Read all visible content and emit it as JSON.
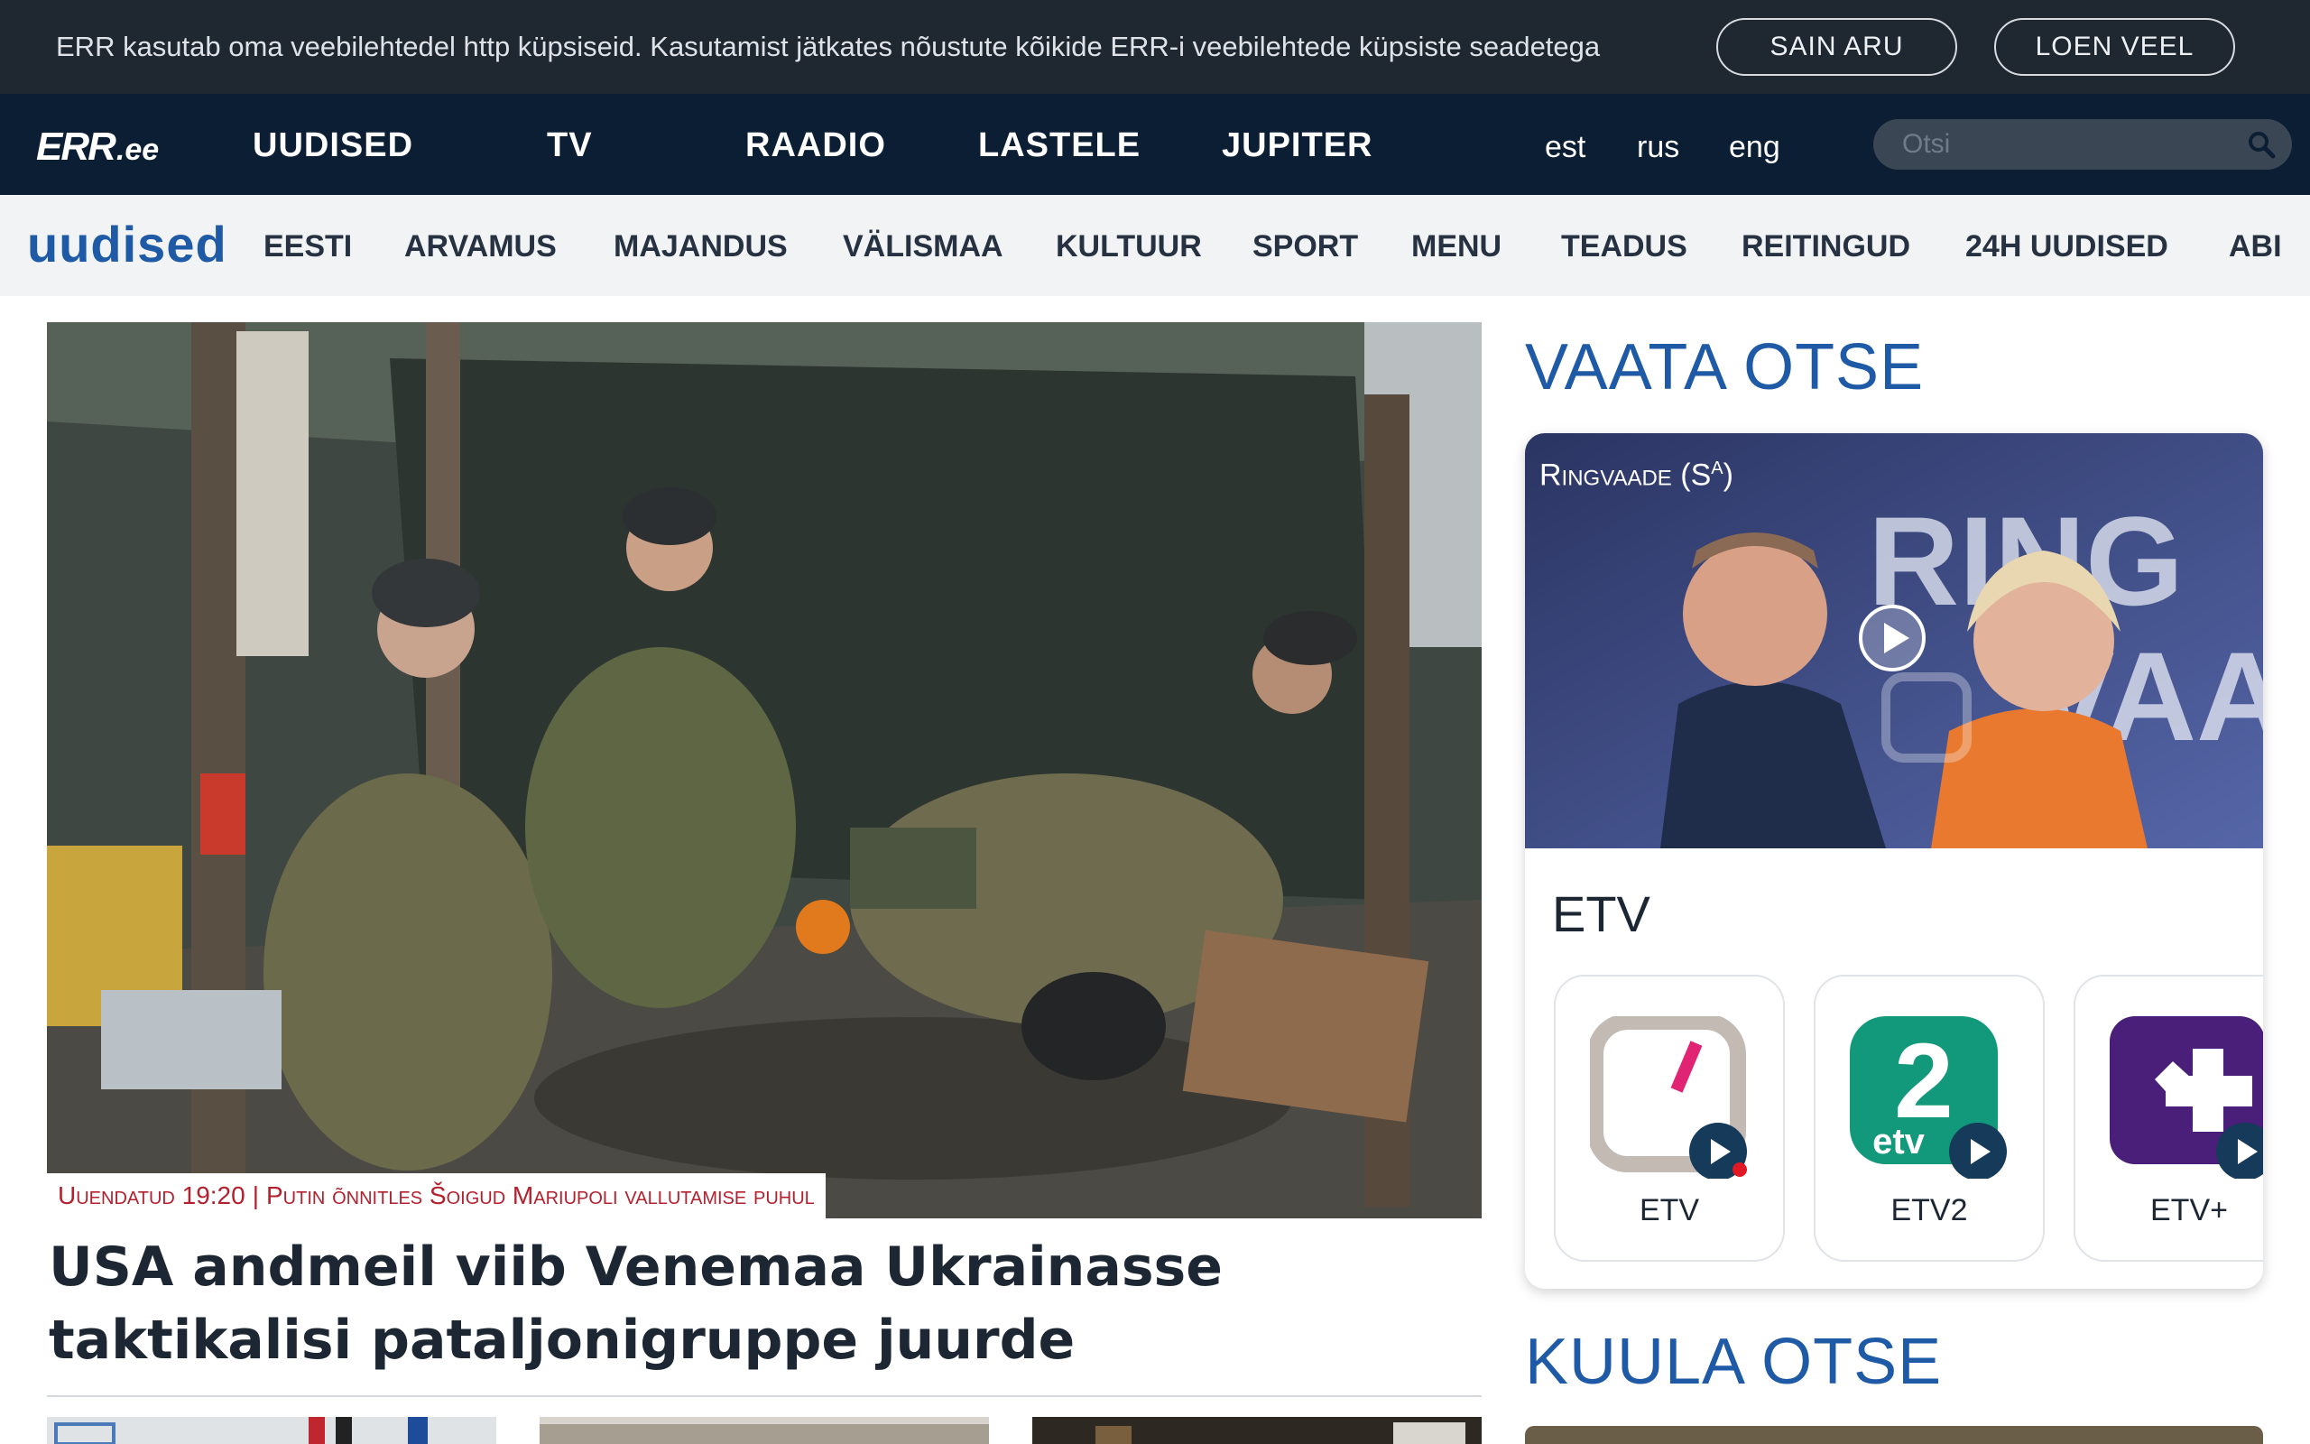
{
  "cookie": {
    "text": "ERR kasutab oma veebilehtedel http küpsiseid. Kasutamist jätkates nõustute kõikide ERR-i veebilehtede küpsiste seadetega",
    "accept_label": "SAIN ARU",
    "more_label": "LOEN VEEL"
  },
  "header": {
    "logo_main": "ERR",
    "logo_suffix": ".ee",
    "nav": [
      "UUDISED",
      "TV",
      "RAADIO",
      "LASTELE",
      "JUPITER"
    ],
    "languages": [
      "est",
      "rus",
      "eng"
    ],
    "search_placeholder": "Otsi"
  },
  "subnav": {
    "title": "uudised",
    "items": [
      "EESTI",
      "ARVAMUS",
      "MAJANDUS",
      "VÄLISMAA",
      "KULTUUR",
      "SPORT",
      "MENU",
      "TEADUS",
      "REITINGUD",
      "24H UUDISED",
      "ABI"
    ]
  },
  "hero": {
    "caption_prefix": "Uuendatud 19:20",
    "caption_separator": "|",
    "caption_text": "Putin õnnitles Šoigud Mariupoli vallutamise puhul",
    "headline": "USA andmeil viib Venemaa Ukrainasse taktikalisi pataljonigruppe juurde"
  },
  "live": {
    "title": "VAATA OTSE",
    "now_showing": "Ringvaade (S",
    "now_showing_sup": "a",
    "now_showing_end": ")",
    "channel_name": "ETV",
    "channels": [
      {
        "label": "ETV",
        "icon": "etv-logo-icon"
      },
      {
        "label": "ETV2",
        "icon": "etv2-logo-icon"
      },
      {
        "label": "ETV+",
        "icon": "etv-plus-logo-icon"
      }
    ]
  },
  "radio": {
    "title": "KUULA OTSE"
  },
  "colors": {
    "cookie_bg": "#1f2731",
    "nav_bg": "#0c1e33",
    "subnav_bg": "#f2f3f5",
    "brand_blue": "#1f5aa6",
    "caption_red": "#b3202e"
  }
}
